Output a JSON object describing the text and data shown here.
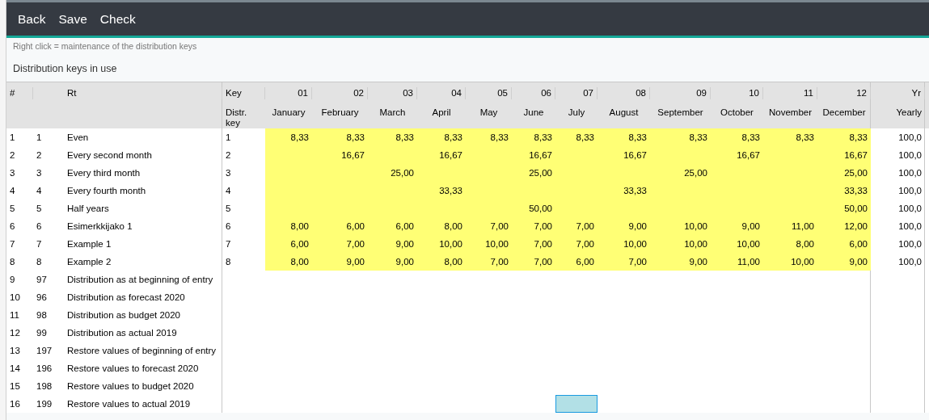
{
  "toolbar": {
    "buttons": [
      "Back",
      "Save",
      "Check"
    ]
  },
  "hint": "Right click = maintenance of the distribution keys",
  "section_title": "Distribution keys in use",
  "table": {
    "columns": [
      {
        "kind": "index",
        "title": "#"
      },
      {
        "kind": "number"
      },
      {
        "kind": "text",
        "title": "Rt"
      },
      {
        "kind": "key",
        "title": "Key",
        "subtitle": "Distr. key"
      },
      {
        "kind": "month",
        "title": "01",
        "subtitle": "January"
      },
      {
        "kind": "month",
        "title": "02",
        "subtitle": "February"
      },
      {
        "kind": "month",
        "title": "03",
        "subtitle": "March"
      },
      {
        "kind": "month",
        "title": "04",
        "subtitle": "April"
      },
      {
        "kind": "month",
        "title": "05",
        "subtitle": "May"
      },
      {
        "kind": "month",
        "title": "06",
        "subtitle": "June"
      },
      {
        "kind": "month",
        "title": "07",
        "subtitle": "July"
      },
      {
        "kind": "month",
        "title": "08",
        "subtitle": "August"
      },
      {
        "kind": "month",
        "title": "09",
        "subtitle": "September"
      },
      {
        "kind": "month",
        "title": "10",
        "subtitle": "October"
      },
      {
        "kind": "month",
        "title": "11",
        "subtitle": "November"
      },
      {
        "kind": "month",
        "title": "12",
        "subtitle": "December"
      },
      {
        "kind": "total",
        "title": "Yr",
        "subtitle": "Yearly"
      }
    ],
    "rows": [
      {
        "index": "1",
        "number": "1",
        "name": "Even",
        "key": "1",
        "highlighted": true,
        "cells": [
          {
            "kind": "value",
            "value": "8,33"
          },
          {
            "kind": "value",
            "value": "8,33"
          },
          {
            "kind": "value",
            "value": "8,33"
          },
          {
            "kind": "value",
            "value": "8,33"
          },
          {
            "kind": "value",
            "value": "8,33"
          },
          {
            "kind": "value",
            "value": "8,33"
          },
          {
            "kind": "value",
            "value": "8,33"
          },
          {
            "kind": "value",
            "value": "8,33"
          },
          {
            "kind": "value",
            "value": "8,33"
          },
          {
            "kind": "value",
            "value": "8,33"
          },
          {
            "kind": "value",
            "value": "8,33"
          },
          {
            "kind": "value",
            "value": "8,33"
          }
        ],
        "yearly": "100,0"
      },
      {
        "index": "2",
        "number": "2",
        "name": "Every second month",
        "key": "2",
        "highlighted": true,
        "cells": [
          {
            "kind": "blank"
          },
          {
            "kind": "value",
            "value": "16,67"
          },
          {
            "kind": "blank"
          },
          {
            "kind": "value",
            "value": "16,67"
          },
          {
            "kind": "blank"
          },
          {
            "kind": "value",
            "value": "16,67"
          },
          {
            "kind": "blank"
          },
          {
            "kind": "value",
            "value": "16,67"
          },
          {
            "kind": "blank"
          },
          {
            "kind": "value",
            "value": "16,67"
          },
          {
            "kind": "blank"
          },
          {
            "kind": "value",
            "value": "16,67"
          }
        ],
        "yearly": "100,0"
      },
      {
        "index": "3",
        "number": "3",
        "name": "Every third month",
        "key": "3",
        "highlighted": true,
        "cells": [
          {
            "kind": "blank"
          },
          {
            "kind": "blank"
          },
          {
            "kind": "value",
            "value": "25,00"
          },
          {
            "kind": "blank"
          },
          {
            "kind": "blank"
          },
          {
            "kind": "value",
            "value": "25,00"
          },
          {
            "kind": "blank"
          },
          {
            "kind": "blank"
          },
          {
            "kind": "value",
            "value": "25,00"
          },
          {
            "kind": "blank"
          },
          {
            "kind": "blank"
          },
          {
            "kind": "value",
            "value": "25,00"
          }
        ],
        "yearly": "100,0"
      },
      {
        "index": "4",
        "number": "4",
        "name": "Every fourth month",
        "key": "4",
        "highlighted": true,
        "cells": [
          {
            "kind": "blank"
          },
          {
            "kind": "blank"
          },
          {
            "kind": "blank"
          },
          {
            "kind": "value",
            "value": "33,33"
          },
          {
            "kind": "blank"
          },
          {
            "kind": "blank"
          },
          {
            "kind": "blank"
          },
          {
            "kind": "value",
            "value": "33,33"
          },
          {
            "kind": "blank"
          },
          {
            "kind": "blank"
          },
          {
            "kind": "blank"
          },
          {
            "kind": "value",
            "value": "33,33"
          }
        ],
        "yearly": "100,0"
      },
      {
        "index": "5",
        "number": "5",
        "name": "Half years",
        "key": "5",
        "highlighted": true,
        "cells": [
          {
            "kind": "blank"
          },
          {
            "kind": "blank"
          },
          {
            "kind": "blank"
          },
          {
            "kind": "blank"
          },
          {
            "kind": "blank"
          },
          {
            "kind": "value",
            "value": "50,00"
          },
          {
            "kind": "blank"
          },
          {
            "kind": "blank"
          },
          {
            "kind": "blank"
          },
          {
            "kind": "blank"
          },
          {
            "kind": "blank"
          },
          {
            "kind": "value",
            "value": "50,00"
          }
        ],
        "yearly": "100,0"
      },
      {
        "index": "6",
        "number": "6",
        "name": "Esimerkkijako 1",
        "key": "6",
        "highlighted": true,
        "cells": [
          {
            "kind": "value",
            "value": "8,00"
          },
          {
            "kind": "value",
            "value": "6,00"
          },
          {
            "kind": "value",
            "value": "6,00"
          },
          {
            "kind": "value",
            "value": "8,00"
          },
          {
            "kind": "value",
            "value": "7,00"
          },
          {
            "kind": "value",
            "value": "7,00"
          },
          {
            "kind": "value",
            "value": "7,00"
          },
          {
            "kind": "value",
            "value": "9,00"
          },
          {
            "kind": "value",
            "value": "10,00"
          },
          {
            "kind": "value",
            "value": "9,00"
          },
          {
            "kind": "value",
            "value": "11,00"
          },
          {
            "kind": "value",
            "value": "12,00"
          }
        ],
        "yearly": "100,0"
      },
      {
        "index": "7",
        "number": "7",
        "name": "Example 1",
        "key": "7",
        "highlighted": true,
        "cells": [
          {
            "kind": "value",
            "value": "6,00"
          },
          {
            "kind": "value",
            "value": "7,00"
          },
          {
            "kind": "value",
            "value": "9,00"
          },
          {
            "kind": "value",
            "value": "10,00"
          },
          {
            "kind": "value",
            "value": "10,00"
          },
          {
            "kind": "value",
            "value": "7,00"
          },
          {
            "kind": "value",
            "value": "7,00"
          },
          {
            "kind": "value",
            "value": "10,00"
          },
          {
            "kind": "value",
            "value": "10,00"
          },
          {
            "kind": "value",
            "value": "10,00"
          },
          {
            "kind": "value",
            "value": "8,00"
          },
          {
            "kind": "value",
            "value": "6,00"
          }
        ],
        "yearly": "100,0"
      },
      {
        "index": "8",
        "number": "8",
        "name": "Example 2",
        "key": "8",
        "highlighted": true,
        "cells": [
          {
            "kind": "value",
            "value": "8,00"
          },
          {
            "kind": "value",
            "value": "9,00"
          },
          {
            "kind": "value",
            "value": "9,00"
          },
          {
            "kind": "value",
            "value": "8,00"
          },
          {
            "kind": "value",
            "value": "7,00"
          },
          {
            "kind": "value",
            "value": "7,00"
          },
          {
            "kind": "value",
            "value": "6,00"
          },
          {
            "kind": "value",
            "value": "7,00"
          },
          {
            "kind": "value",
            "value": "9,00"
          },
          {
            "kind": "value",
            "value": "11,00"
          },
          {
            "kind": "value",
            "value": "10,00"
          },
          {
            "kind": "value",
            "value": "9,00"
          }
        ],
        "yearly": "100,0"
      },
      {
        "index": "9",
        "number": "97",
        "name": "Distribution as at beginning of entry",
        "highlighted": false
      },
      {
        "index": "10",
        "number": "96",
        "name": "Distribution as forecast 2020",
        "highlighted": false
      },
      {
        "index": "11",
        "number": "98",
        "name": "Distribution as budget 2020",
        "highlighted": false
      },
      {
        "index": "12",
        "number": "99",
        "name": "Distribution as actual 2019",
        "highlighted": false
      },
      {
        "index": "13",
        "number": "197",
        "name": "Restore values of beginning of entry",
        "highlighted": false
      },
      {
        "index": "14",
        "number": "196",
        "name": "Restore values to forecast 2020",
        "highlighted": false
      },
      {
        "index": "15",
        "number": "198",
        "name": "Restore values to budget 2020",
        "highlighted": false
      },
      {
        "index": "16",
        "number": "199",
        "name": "Restore values to actual 2019",
        "highlighted": false,
        "cells": [
          {
            "kind": "blank"
          },
          {
            "kind": "blank"
          },
          {
            "kind": "blank"
          },
          {
            "kind": "blank"
          },
          {
            "kind": "blank"
          },
          {
            "kind": "blank"
          },
          {
            "kind": "cursor"
          },
          {
            "kind": "blank"
          },
          {
            "kind": "blank"
          },
          {
            "kind": "blank"
          },
          {
            "kind": "blank"
          },
          {
            "kind": "blank"
          }
        ]
      }
    ]
  }
}
